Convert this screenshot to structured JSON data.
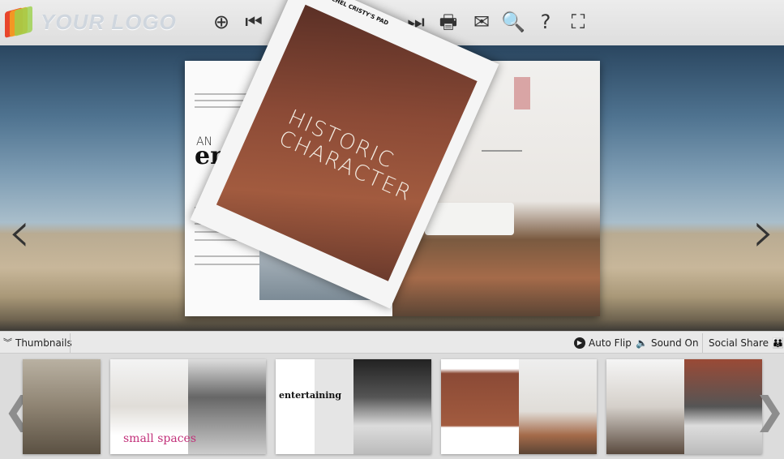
{
  "logo": {
    "text": "YOUR LOGO"
  },
  "toolbar": {
    "buttons": [
      {
        "name": "zoom-in",
        "glyph": "⊕"
      },
      {
        "name": "first-page",
        "glyph": "⏮"
      },
      {
        "name": "previous-page",
        "glyph": "◀"
      },
      {
        "name": "play",
        "glyph": "■"
      },
      {
        "name": "next-page",
        "glyph": "▶"
      },
      {
        "name": "last-page",
        "glyph": "⏭"
      },
      {
        "name": "print",
        "glyph": "🖶"
      },
      {
        "name": "email",
        "glyph": "✉"
      },
      {
        "name": "search",
        "glyph": "🔍"
      },
      {
        "name": "help",
        "glyph": "?"
      },
      {
        "name": "fullscreen",
        "glyph": "⛶"
      }
    ]
  },
  "book": {
    "left_page": {
      "an": "AN",
      "headline": "entert"
    },
    "flip_page": {
      "header": "THE RACHEL CRISTY'S PAD",
      "title": "HISTORIC CHARACTER"
    }
  },
  "bottombar": {
    "thumbnails": "Thumbnails",
    "auto_flip": "Auto Flip",
    "sound_on": "Sound On",
    "social_share": "Social Share"
  },
  "thumbnails": [
    {
      "label": ""
    },
    {
      "label": "small spaces"
    },
    {
      "label": "entertaining"
    },
    {
      "label": ""
    },
    {
      "label": ""
    }
  ]
}
